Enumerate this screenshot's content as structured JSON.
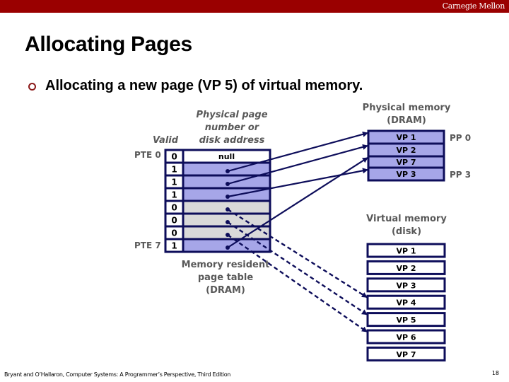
{
  "header": {
    "brand": "Carnegie Mellon",
    "bar_color": "#9a0000"
  },
  "slide": {
    "title": "Allocating Pages",
    "bullet": "Allocating a new page (VP 5) of virtual memory."
  },
  "page_table": {
    "col_valid_label": "Valid",
    "col_addr_label_lines": [
      "Physical page",
      "number or",
      "disk address"
    ],
    "first_pte_label": "PTE 0",
    "last_pte_label": "PTE 7",
    "caption_lines": [
      "Memory resident",
      "page table",
      "(DRAM)"
    ],
    "rows": [
      {
        "valid": "0",
        "content": "null",
        "state": "null"
      },
      {
        "valid": "1",
        "content": "",
        "state": "resident",
        "points_to": "dram:0"
      },
      {
        "valid": "1",
        "content": "",
        "state": "resident",
        "points_to": "dram:1"
      },
      {
        "valid": "1",
        "content": "",
        "state": "resident",
        "points_to": "dram:3"
      },
      {
        "valid": "0",
        "content": "",
        "state": "disk",
        "points_to": "disk:3"
      },
      {
        "valid": "0",
        "content": "",
        "state": "disk",
        "points_to": "disk:4"
      },
      {
        "valid": "0",
        "content": "",
        "state": "disk",
        "points_to": "disk:5"
      },
      {
        "valid": "1",
        "content": "",
        "state": "resident",
        "points_to": "dram:2"
      }
    ]
  },
  "physical_memory": {
    "title_lines": [
      "Physical memory",
      "(DRAM)"
    ],
    "pages": [
      "VP 1",
      "VP 2",
      "VP 7",
      "VP 3"
    ],
    "pp_first_label": "PP 0",
    "pp_last_label": "PP 3"
  },
  "virtual_memory": {
    "title_lines": [
      "Virtual memory",
      "(disk)"
    ],
    "pages": [
      "VP 1",
      "VP 2",
      "VP 3",
      "VP 4",
      "VP 5",
      "VP 6",
      "VP 7"
    ]
  },
  "colors": {
    "navy": "#0d0d5a",
    "resident_fill": "#a6a6e8",
    "disk_fill": "#d9d9d9",
    "caption_gray": "#595959"
  },
  "footer": {
    "citation": "Bryant and O’Hallaron, Computer Systems: A Programmer’s Perspective, Third Edition",
    "page_number": "18"
  }
}
